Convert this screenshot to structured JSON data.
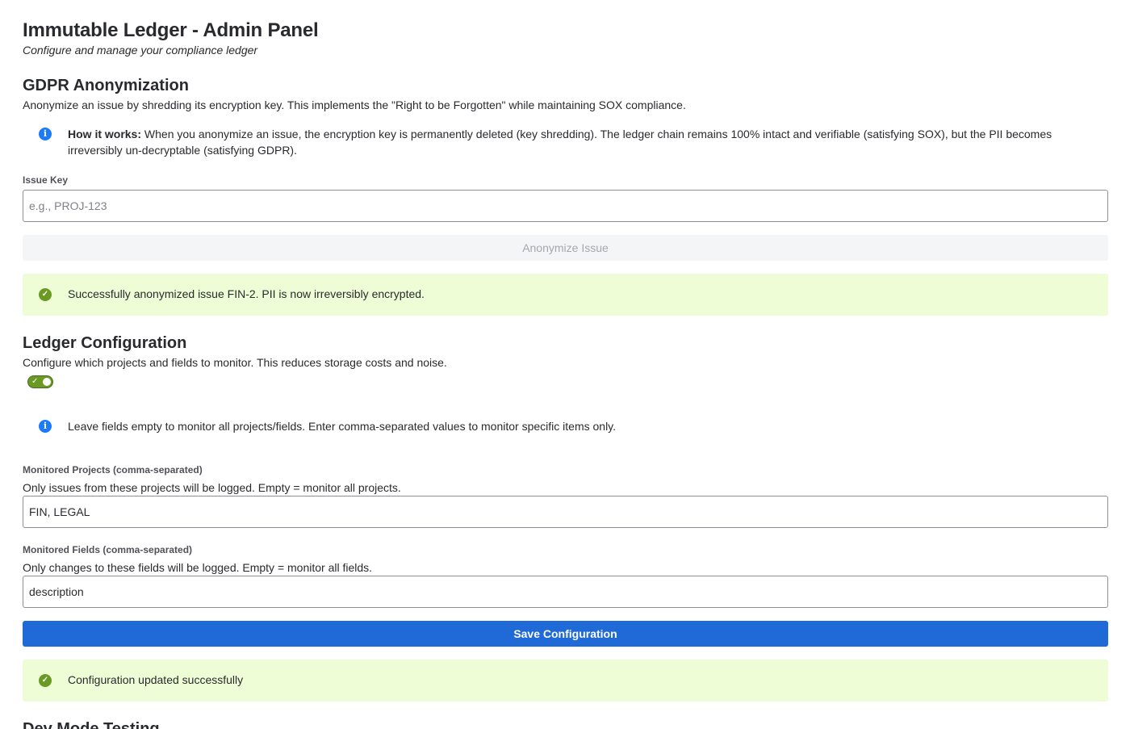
{
  "header": {
    "title": "Immutable Ledger - Admin Panel",
    "subtitle": "Configure and manage your compliance ledger"
  },
  "gdpr": {
    "title": "GDPR Anonymization",
    "description": "Anonymize an issue by shredding its encryption key. This implements the \"Right to be Forgotten\" while maintaining SOX compliance.",
    "info_icon": "info-icon",
    "info_bold": "How it works:",
    "info_text": " When you anonymize an issue, the encryption key is permanently deleted (key shredding). The ledger chain remains 100% intact and verifiable (satisfying SOX), but the PII becomes irreversibly un-decryptable (satisfying GDPR).",
    "issue_key_label": "Issue Key",
    "issue_key_placeholder": "e.g., PROJ-123",
    "issue_key_value": "",
    "anonymize_button": "Anonymize Issue",
    "success_icon": "check-circle-icon",
    "success_message": "Successfully anonymized issue FIN-2. PII is now irreversibly encrypted."
  },
  "ledger_config": {
    "title": "Ledger Configuration",
    "description": "Configure which projects and fields to monitor. This reduces storage costs and noise.",
    "toggle_enabled": true,
    "info_text": "Leave fields empty to monitor all projects/fields. Enter comma-separated values to monitor specific items only.",
    "projects_label": "Monitored Projects (comma-separated)",
    "projects_help": "Only issues from these projects will be logged. Empty = monitor all projects.",
    "projects_value": "FIN, LEGAL",
    "fields_label": "Monitored Fields (comma-separated)",
    "fields_help": "Only changes to these fields will be logged. Empty = monitor all fields.",
    "fields_value": "description",
    "save_button": "Save Configuration",
    "success_message": "Configuration updated successfully"
  },
  "dev_mode": {
    "title": "Dev Mode Testing"
  },
  "colors": {
    "primary_button": "#1f6ad6",
    "success_bg": "#effdd6",
    "success_icon": "#6a9a23",
    "info_icon": "#1d7afc",
    "toggle_on": "#6a9a23"
  }
}
